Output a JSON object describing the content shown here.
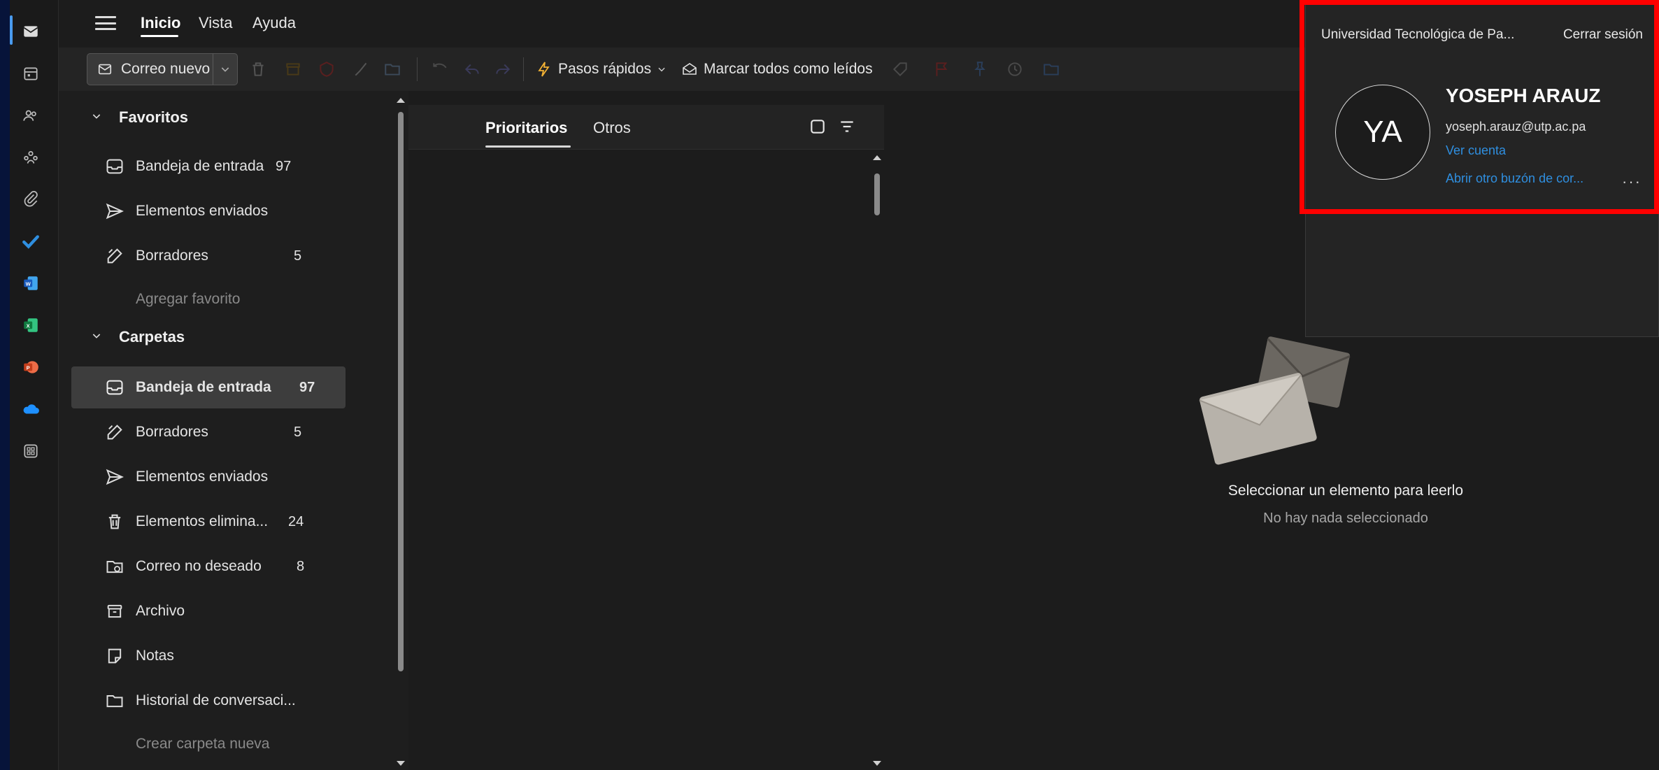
{
  "app": {
    "menu": [
      {
        "label": "Inicio",
        "active": true
      },
      {
        "label": "Vista",
        "active": false
      },
      {
        "label": "Ayuda",
        "active": false
      }
    ]
  },
  "toolbar": {
    "new_mail_label": "Correo nuevo",
    "quick_steps_label": "Pasos rápidos",
    "mark_all_read_label": "Marcar todos como leídos"
  },
  "folders": {
    "favorites_header": "Favoritos",
    "favorites": [
      {
        "label": "Bandeja de entrada",
        "count": "97",
        "icon": "inbox-icon"
      },
      {
        "label": "Elementos enviados",
        "count": "",
        "icon": "send-icon"
      },
      {
        "label": "Borradores",
        "count": "5",
        "icon": "drafts-icon"
      }
    ],
    "add_favorite": "Agregar favorito",
    "folders_header": "Carpetas",
    "items": [
      {
        "label": "Bandeja de entrada",
        "count": "97",
        "icon": "inbox-icon",
        "selected": true
      },
      {
        "label": "Borradores",
        "count": "5",
        "icon": "drafts-icon"
      },
      {
        "label": "Elementos enviados",
        "count": "",
        "icon": "send-icon"
      },
      {
        "label": "Elementos elimina...",
        "count": "24",
        "icon": "trash-icon"
      },
      {
        "label": "Correo no deseado",
        "count": "8",
        "icon": "junk-icon"
      },
      {
        "label": "Archivo",
        "count": "",
        "icon": "archive-icon"
      },
      {
        "label": "Notas",
        "count": "",
        "icon": "note-icon"
      },
      {
        "label": "Historial de conversaci...",
        "count": "",
        "icon": "folder-icon"
      }
    ],
    "create_folder": "Crear carpeta nueva"
  },
  "message_list": {
    "tabs": [
      "Prioritarios",
      "Otros"
    ]
  },
  "reading_pane": {
    "title": "Seleccionar un elemento para leerlo",
    "subtitle": "No hay nada seleccionado"
  },
  "account": {
    "organization": "Universidad Tecnológica de Pa...",
    "sign_out": "Cerrar sesión",
    "initials": "YA",
    "name": "YOSEPH ARAUZ",
    "email": "yoseph.arauz@utp.ac.pa",
    "view_account": "Ver cuenta",
    "open_other_mailbox": "Abrir otro buzón de cor...",
    "more": "···"
  },
  "colors": {
    "accent": "#2f8fe0",
    "highlight": "#ff0000",
    "background": "#1c1c1c"
  }
}
